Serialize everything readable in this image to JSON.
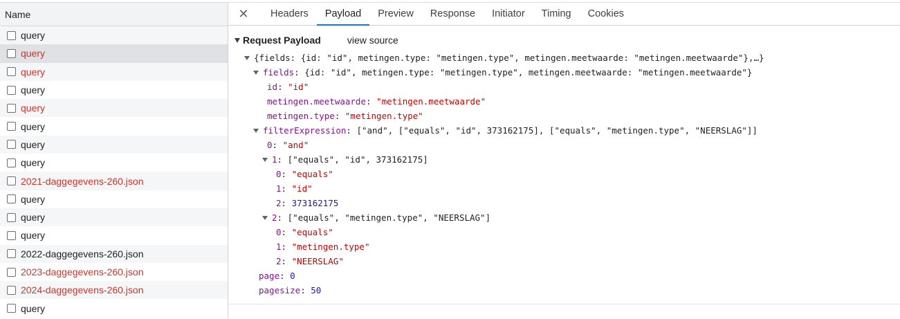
{
  "left_panel": {
    "header": "Name",
    "requests": [
      {
        "name": "query",
        "error": false,
        "state": "alt"
      },
      {
        "name": "query",
        "error": true,
        "state": "selected"
      },
      {
        "name": "query",
        "error": true,
        "state": "alt"
      },
      {
        "name": "query",
        "error": false,
        "state": ""
      },
      {
        "name": "query",
        "error": true,
        "state": "alt"
      },
      {
        "name": "query",
        "error": false,
        "state": ""
      },
      {
        "name": "query",
        "error": false,
        "state": "alt"
      },
      {
        "name": "query",
        "error": false,
        "state": ""
      },
      {
        "name": "2021-daggegevens-260.json",
        "error": true,
        "state": "alt"
      },
      {
        "name": "query",
        "error": false,
        "state": ""
      },
      {
        "name": "query",
        "error": false,
        "state": "alt"
      },
      {
        "name": "query",
        "error": false,
        "state": ""
      },
      {
        "name": "2022-daggegevens-260.json",
        "error": false,
        "state": "alt"
      },
      {
        "name": "2023-daggegevens-260.json",
        "error": true,
        "state": ""
      },
      {
        "name": "2024-daggegevens-260.json",
        "error": true,
        "state": "alt"
      },
      {
        "name": "query",
        "error": false,
        "state": ""
      }
    ]
  },
  "tabs": {
    "close_icon": "close-icon",
    "items": [
      "Headers",
      "Payload",
      "Preview",
      "Response",
      "Initiator",
      "Timing",
      "Cookies"
    ],
    "active": "Payload"
  },
  "payload": {
    "section_title": "Request Payload",
    "view_source": "view source",
    "root_summary": "{fields: {id: \"id\", metingen.type: \"metingen.type\", metingen.meetwaarde: \"metingen.meetwaarde\"},…}",
    "fields": {
      "key": "fields",
      "summary": "{id: \"id\", metingen.type: \"metingen.type\", metingen.meetwaarde: \"metingen.meetwaarde\"}",
      "children": [
        {
          "key": "id",
          "value": "\"id\""
        },
        {
          "key": "metingen.meetwaarde",
          "value": "\"metingen.meetwaarde\""
        },
        {
          "key": "metingen.type",
          "value": "\"metingen.type\""
        }
      ]
    },
    "filterExpression": {
      "key": "filterExpression",
      "summary": "[\"and\", [\"equals\", \"id\", 373162175], [\"equals\", \"metingen.type\", \"NEERSLAG\"]]",
      "item0": {
        "key": "0",
        "value": "\"and\""
      },
      "item1": {
        "key": "1",
        "summary": "[\"equals\", \"id\", 373162175]",
        "children": [
          {
            "key": "0",
            "value": "\"equals\""
          },
          {
            "key": "1",
            "value": "\"id\""
          },
          {
            "key": "2",
            "value": "373162175"
          }
        ]
      },
      "item2": {
        "key": "2",
        "summary": "[\"equals\", \"metingen.type\", \"NEERSLAG\"]",
        "children": [
          {
            "key": "0",
            "value": "\"equals\""
          },
          {
            "key": "1",
            "value": "\"metingen.type\""
          },
          {
            "key": "2",
            "value": "\"NEERSLAG\""
          }
        ]
      }
    },
    "page": {
      "key": "page",
      "value": "0"
    },
    "pagesize": {
      "key": "pagesize",
      "value": "50"
    }
  }
}
